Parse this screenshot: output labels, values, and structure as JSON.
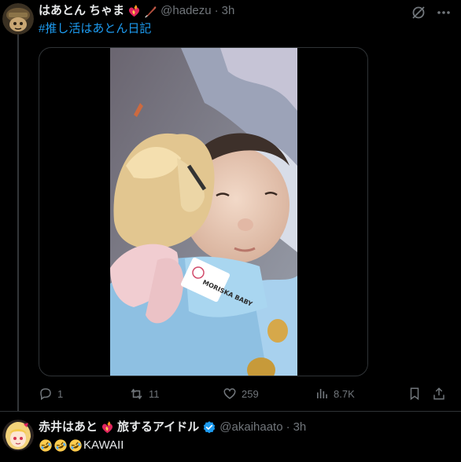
{
  "post": {
    "author_name": "はあとん ちゃま",
    "author_handle": "@hadezu",
    "separator": "·",
    "time": "3h",
    "hashtag": "#推し活はあとん日記",
    "media_label": "MORISKA BABY",
    "actions": {
      "reply_count": "1",
      "repost_count": "11",
      "like_count": "259",
      "view_count": "8.7K"
    }
  },
  "reply": {
    "author_name_part1": "赤井はあと",
    "author_name_part2": "旅するアイドル",
    "author_handle": "@akaihaato",
    "separator": "·",
    "time": "3h",
    "text": "KAWAII"
  },
  "colors": {
    "background": "#000000",
    "text": "#e7e9ea",
    "muted": "#71767b",
    "link": "#1d9bf0",
    "border": "#2f3336",
    "verified": "#1d9bf0"
  },
  "icons": [
    "grok-icon",
    "more-icon",
    "reply-icon",
    "repost-icon",
    "like-icon",
    "views-icon",
    "bookmark-icon",
    "share-icon",
    "verified-badge-icon",
    "fire-heart-emoji",
    "quill-emoji",
    "rofl-emoji"
  ]
}
